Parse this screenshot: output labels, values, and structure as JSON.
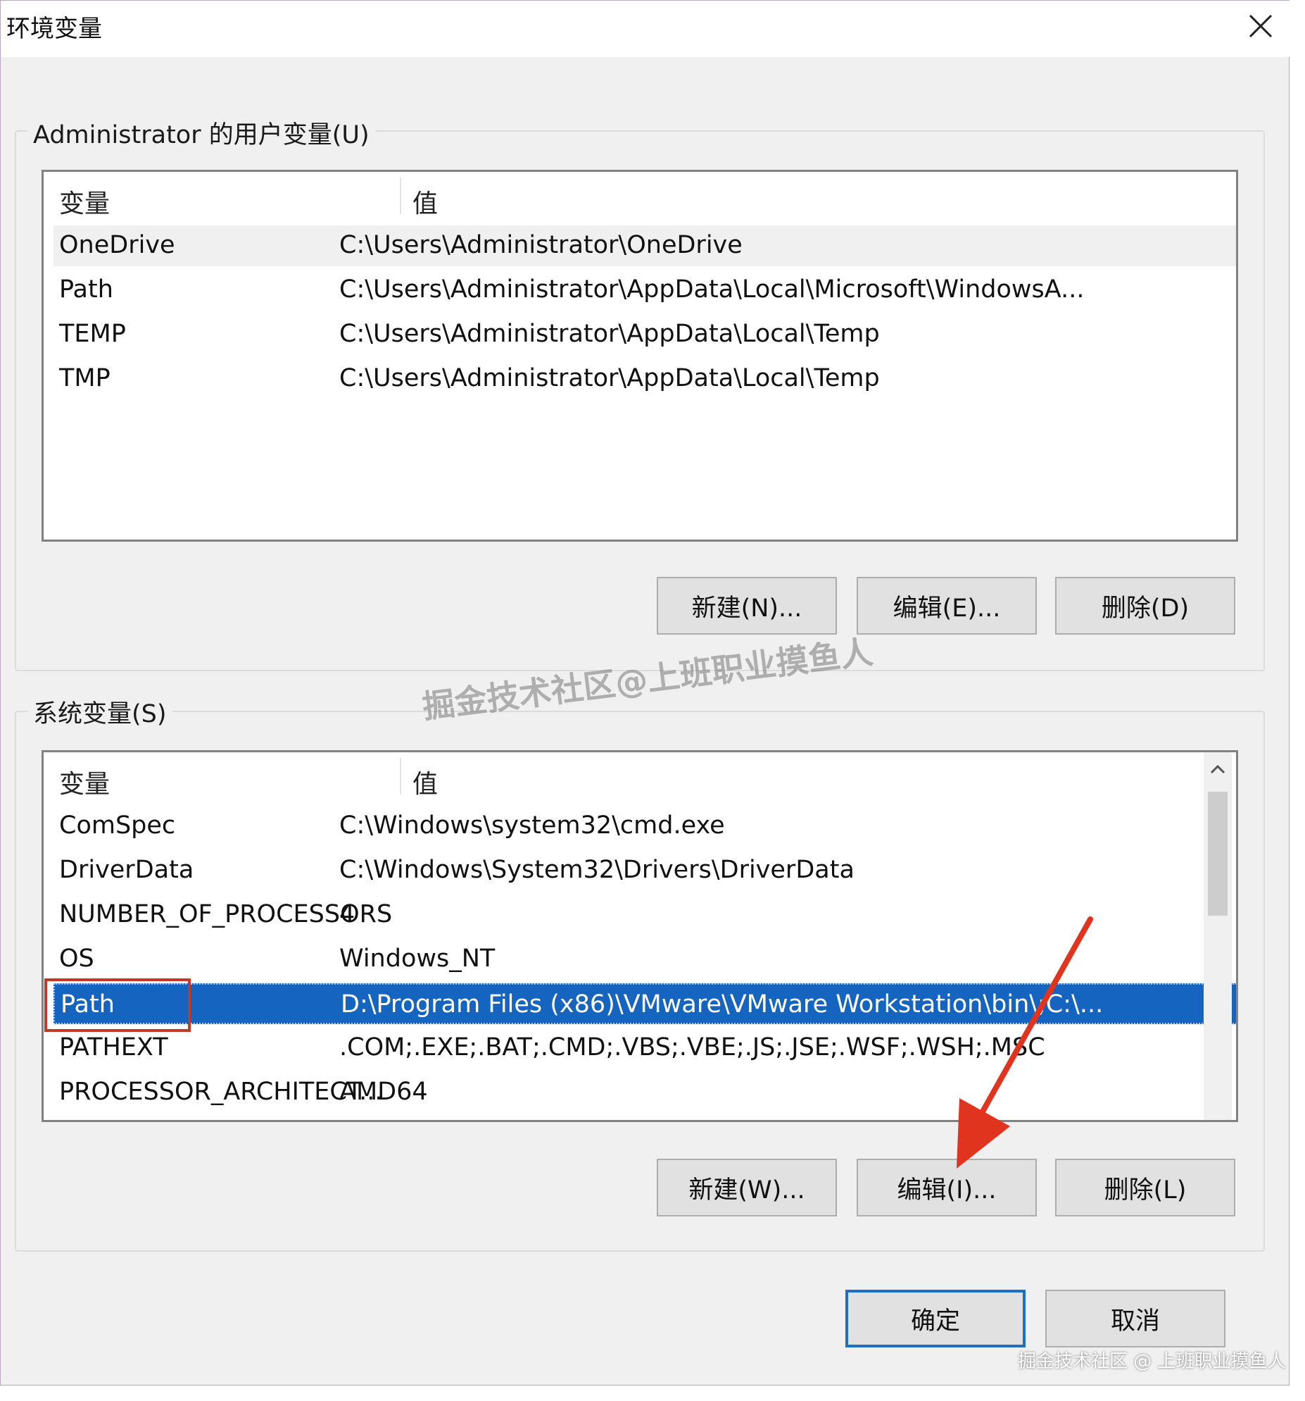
{
  "dialog": {
    "title": "环境变量",
    "close_icon": "close-icon"
  },
  "user_vars": {
    "group_label": "Administrator 的用户变量(U)",
    "col_var": "变量",
    "col_val": "值",
    "rows": [
      {
        "name": "OneDrive",
        "value": "C:\\Users\\Administrator\\OneDrive"
      },
      {
        "name": "Path",
        "value": "C:\\Users\\Administrator\\AppData\\Local\\Microsoft\\WindowsA..."
      },
      {
        "name": "TEMP",
        "value": "C:\\Users\\Administrator\\AppData\\Local\\Temp"
      },
      {
        "name": "TMP",
        "value": "C:\\Users\\Administrator\\AppData\\Local\\Temp"
      }
    ],
    "new_label": "新建(N)...",
    "edit_label": "编辑(E)...",
    "delete_label": "删除(D)"
  },
  "system_vars": {
    "group_label": "系统变量(S)",
    "col_var": "变量",
    "col_val": "值",
    "rows": [
      {
        "name": "ComSpec",
        "value": "C:\\Windows\\system32\\cmd.exe"
      },
      {
        "name": "DriverData",
        "value": "C:\\Windows\\System32\\Drivers\\DriverData"
      },
      {
        "name": "NUMBER_OF_PROCESSORS",
        "value": "4"
      },
      {
        "name": "OS",
        "value": "Windows_NT"
      },
      {
        "name": "Path",
        "value": "D:\\Program Files (x86)\\VMware\\VMware Workstation\\bin\\;C:\\..."
      },
      {
        "name": "PATHEXT",
        "value": ".COM;.EXE;.BAT;.CMD;.VBS;.VBE;.JS;.JSE;.WSF;.WSH;.MSC"
      },
      {
        "name": "PROCESSOR_ARCHITECT...",
        "value": "AMD64"
      }
    ],
    "selected_row": "Path",
    "new_label": "新建(W)...",
    "edit_label": "编辑(I)...",
    "delete_label": "删除(L)"
  },
  "footer": {
    "ok_label": "确定",
    "cancel_label": "取消"
  },
  "watermark": {
    "center": "掘金技术社区@上班职业摸鱼人",
    "corner": "掘金技术社区 @ 上班职业摸鱼人"
  },
  "colors": {
    "selection": "#1565c0",
    "annotation_red": "#e0341f",
    "highlight_box": "#c0392b"
  }
}
